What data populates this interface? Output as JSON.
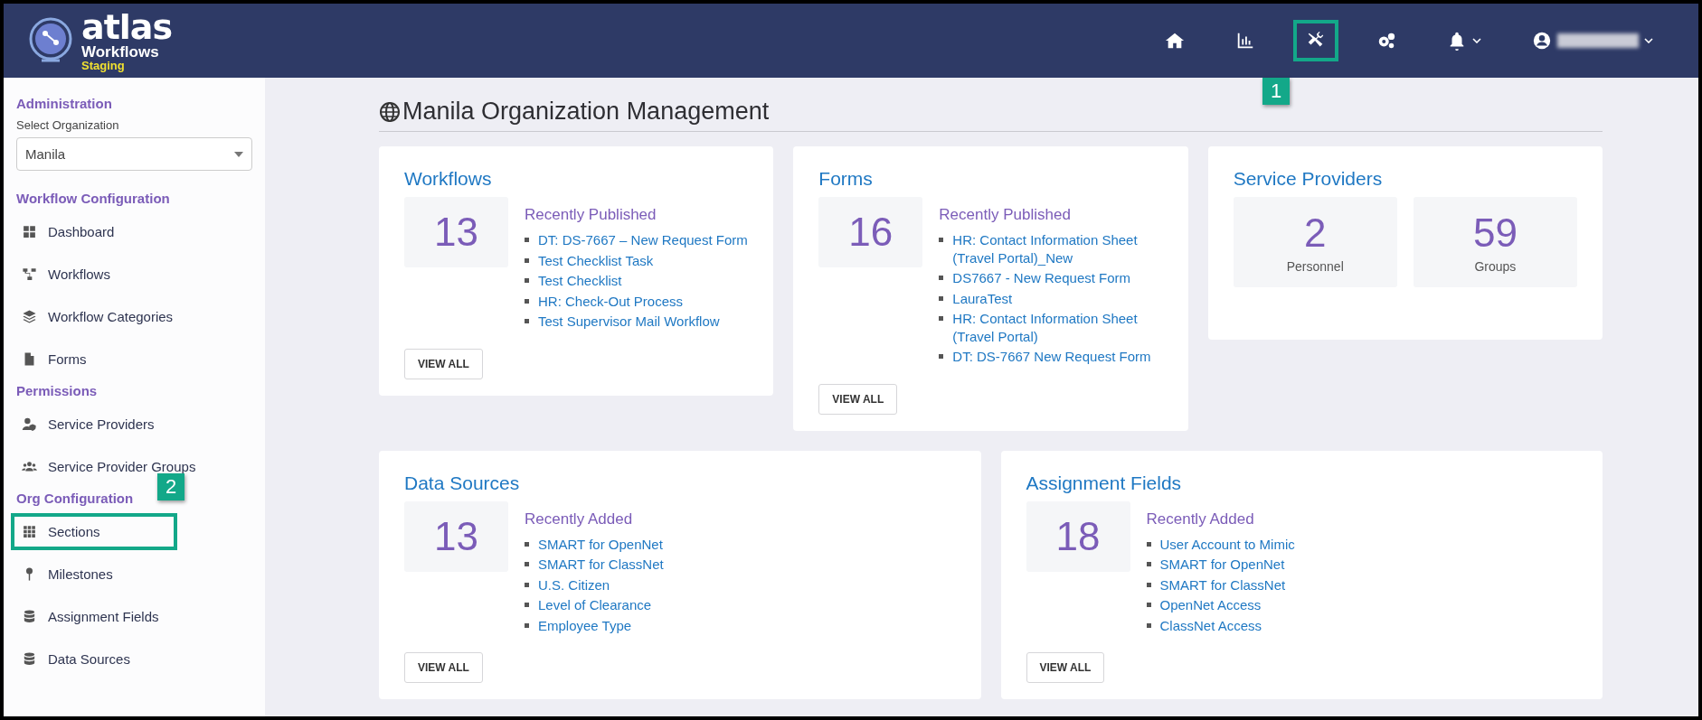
{
  "header": {
    "logo": {
      "name": "atlas",
      "subtitle": "Workflows",
      "environment": "Staging"
    },
    "nav_icons": [
      {
        "kind": "home",
        "highlighted": false
      },
      {
        "kind": "chart",
        "highlighted": false
      },
      {
        "kind": "tools",
        "highlighted": true,
        "callout": "1"
      },
      {
        "kind": "gears",
        "highlighted": false
      },
      {
        "kind": "bell",
        "highlighted": false,
        "dropdown": true
      },
      {
        "kind": "user",
        "highlighted": false,
        "dropdown": true,
        "redacted": true
      }
    ]
  },
  "sidebar": {
    "groups": [
      {
        "heading": "Administration",
        "select": {
          "label": "Select Organization",
          "value": "Manila"
        }
      },
      {
        "heading": "Workflow Configuration",
        "items": [
          {
            "label": "Dashboard",
            "kind": "dashboard",
            "highlighted": false
          },
          {
            "label": "Workflows",
            "kind": "workflows",
            "highlighted": false
          },
          {
            "label": "Workflow Categories",
            "kind": "layers",
            "highlighted": false
          },
          {
            "label": "Forms",
            "kind": "form",
            "highlighted": false
          }
        ]
      },
      {
        "heading": "Permissions",
        "items": [
          {
            "label": "Service Providers",
            "kind": "user-shield",
            "highlighted": false
          },
          {
            "label": "Service Provider Groups",
            "kind": "users",
            "highlighted": false
          }
        ]
      },
      {
        "heading": "Org Configuration",
        "items": [
          {
            "label": "Sections",
            "kind": "grid",
            "highlighted": true,
            "callout": "2"
          },
          {
            "label": "Milestones",
            "kind": "pin",
            "highlighted": false
          },
          {
            "label": "Assignment Fields",
            "kind": "database",
            "highlighted": false
          },
          {
            "label": "Data Sources",
            "kind": "database",
            "highlighted": false
          }
        ]
      }
    ]
  },
  "page_title": "Manila Organization Management",
  "rows": [
    [
      {
        "kind": "list",
        "title": "Workflows",
        "count": "13",
        "list_heading": "Recently Published",
        "links": [
          "DT: DS-7667 – New Request Form",
          "Test Checklist Task",
          "Test Checklist",
          "HR: Check-Out Process",
          "Test Supervisor Mail Workflow"
        ],
        "button": "VIEW ALL"
      },
      {
        "kind": "list",
        "title": "Forms",
        "count": "16",
        "list_heading": "Recently Published",
        "links": [
          "HR: Contact Information Sheet (Travel Portal)_New",
          "DS7667 - New Request Form",
          "LauraTest",
          "HR: Contact Information Sheet (Travel Portal)",
          "DT: DS-7667 New Request Form"
        ],
        "button": "VIEW ALL"
      },
      {
        "kind": "stats",
        "title": "Service Providers",
        "stats": [
          {
            "value": "2",
            "label": "Personnel"
          },
          {
            "value": "59",
            "label": "Groups"
          }
        ]
      }
    ],
    [
      {
        "kind": "list",
        "title": "Data Sources",
        "count": "13",
        "list_heading": "Recently Added",
        "links": [
          "SMART for OpenNet",
          "SMART for ClassNet",
          "U.S. Citizen",
          "Level of Clearance",
          "Employee Type"
        ],
        "button": "VIEW ALL"
      },
      {
        "kind": "list",
        "title": "Assignment Fields",
        "count": "18",
        "list_heading": "Recently Added",
        "links": [
          "User Account to Mimic",
          "SMART for OpenNet",
          "SMART for ClassNet",
          "OpenNet Access",
          "ClassNet Access"
        ],
        "button": "VIEW ALL"
      }
    ]
  ]
}
